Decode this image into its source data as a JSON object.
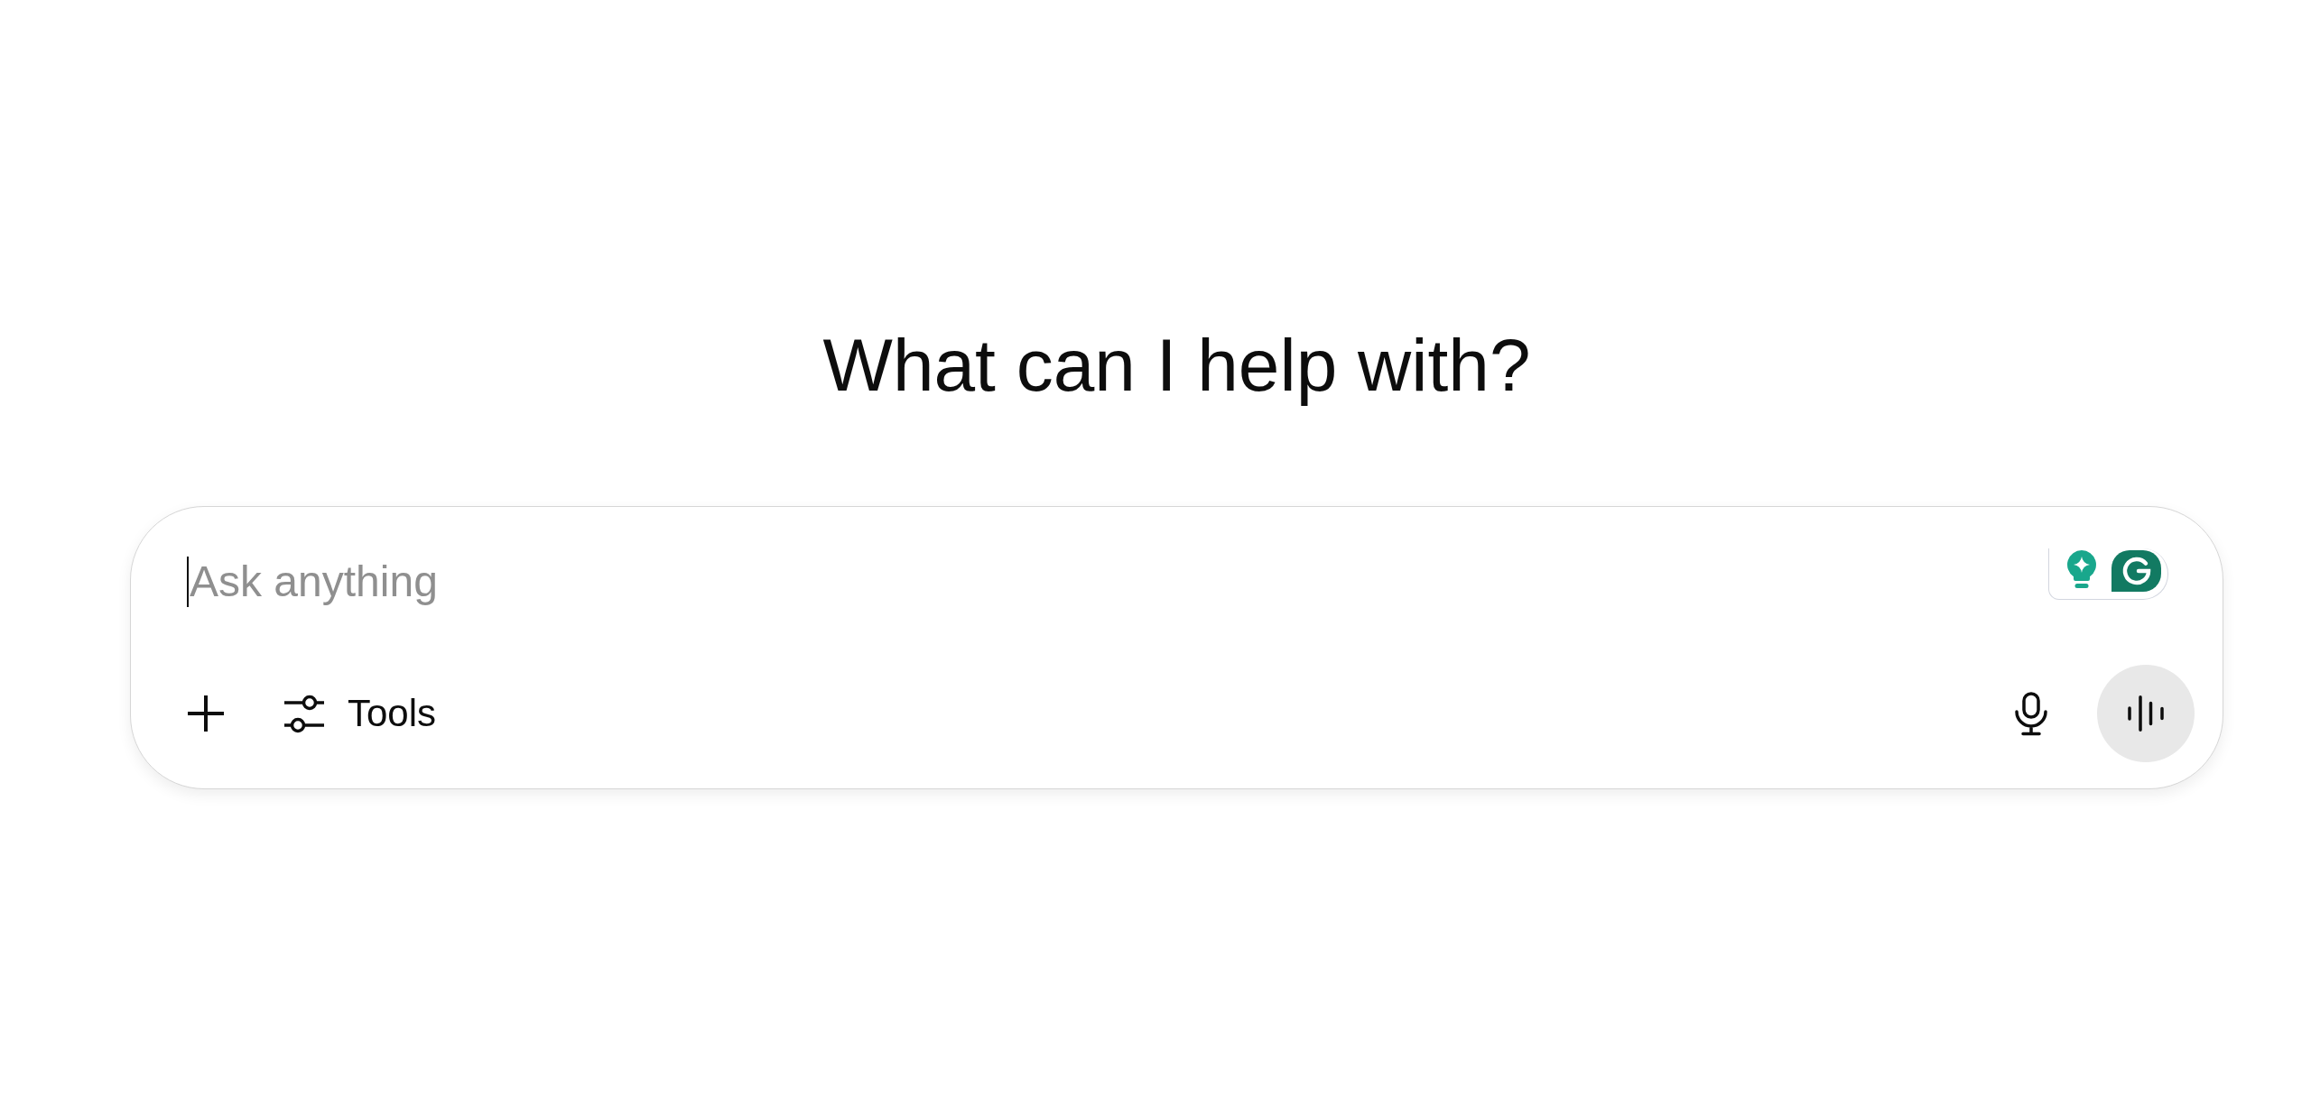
{
  "heading": {
    "text": "What can I help with?"
  },
  "composer": {
    "placeholder": "Ask anything",
    "focused": true,
    "tools_button": {
      "label": "Tools"
    }
  }
}
